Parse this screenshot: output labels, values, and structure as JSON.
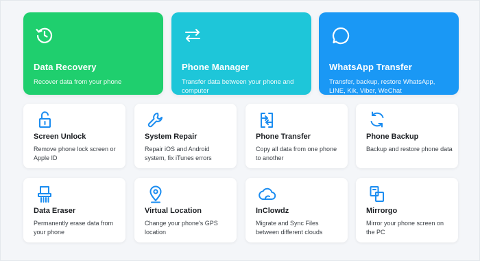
{
  "colors": {
    "data_recovery": "#1fcf6e",
    "phone_manager": "#1ec6d9",
    "whatsapp_transfer": "#1a98f5",
    "icon_blue": "#1a8cf0"
  },
  "featured": [
    {
      "icon": "clock-rewind-icon",
      "title": "Data Recovery",
      "desc": "Recover data from your phone"
    },
    {
      "icon": "swap-arrows-icon",
      "title": "Phone Manager",
      "desc": "Transfer data between your phone and computer"
    },
    {
      "icon": "chat-bubble-icon",
      "title": "WhatsApp Transfer",
      "desc": "Transfer, backup, restore WhatsApp, LINE, Kik, Viber, WeChat"
    }
  ],
  "tools": [
    {
      "icon": "unlock-icon",
      "title": "Screen Unlock",
      "desc": "Remove phone lock screen or Apple ID"
    },
    {
      "icon": "wrench-icon",
      "title": "System Repair",
      "desc": "Repair iOS and Android system, fix iTunes errors"
    },
    {
      "icon": "phone-transfer-icon",
      "title": "Phone Transfer",
      "desc": "Copy all data from one phone to another"
    },
    {
      "icon": "backup-sync-icon",
      "title": "Phone Backup",
      "desc": "Backup and restore phone data"
    },
    {
      "icon": "shredder-icon",
      "title": "Data Eraser",
      "desc": "Permanently erase data from your phone"
    },
    {
      "icon": "location-pin-icon",
      "title": "Virtual Location",
      "desc": "Change your phone's GPS location"
    },
    {
      "icon": "cloud-icon",
      "title": "InClowdz",
      "desc": "Migrate and Sync Files between different clouds"
    },
    {
      "icon": "mirror-screen-icon",
      "title": "Mirrorgo",
      "desc": "Mirror your phone screen on the PC"
    }
  ]
}
